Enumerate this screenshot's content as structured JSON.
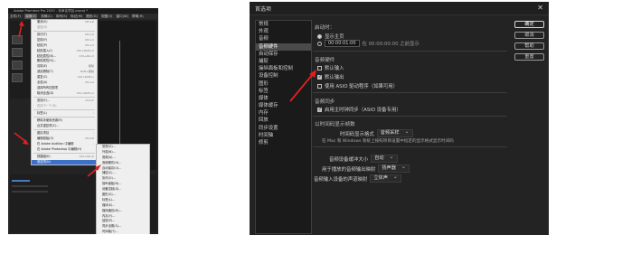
{
  "left_app": {
    "title": "Adobe Premiere Pro 2020 - 未命名项目.prproj *",
    "menubar": [
      "文件(F)",
      "编辑(E)",
      "剪辑(C)",
      "序列(S)",
      "标记(M)",
      "图形(G)",
      "视图(V)",
      "窗口(W)",
      "帮助(H)"
    ],
    "active_menu_index": 1,
    "edit_menu": [
      {
        "label": "撤消(U)",
        "shortcut": "Ctrl+Z"
      },
      {
        "label": "重做(R)",
        "shortcut": "",
        "disabled": true
      },
      {
        "sep": true
      },
      {
        "label": "剪切(T)",
        "shortcut": "Ctrl+X"
      },
      {
        "label": "复制(Y)",
        "shortcut": "Ctrl+C"
      },
      {
        "label": "粘贴(P)",
        "shortcut": "Ctrl+V"
      },
      {
        "label": "粘贴插入(I)",
        "shortcut": "Ctrl+Shift+V"
      },
      {
        "label": "粘贴属性(B)...",
        "shortcut": "Ctrl+Alt+V"
      },
      {
        "label": "删除属性(R)...",
        "shortcut": ""
      },
      {
        "label": "清除(E)",
        "shortcut": "删除"
      },
      {
        "label": "波纹删除(T)",
        "shortcut": "Shift+删除"
      },
      {
        "label": "重复(C)",
        "shortcut": "Ctrl+Shift+/"
      },
      {
        "label": "全选(A)",
        "shortcut": "Ctrl+A"
      },
      {
        "label": "选择所有匹配项",
        "shortcut": ""
      },
      {
        "label": "取消全选(D)",
        "shortcut": "Ctrl+Shift+A"
      },
      {
        "sep": true
      },
      {
        "label": "查找(F)...",
        "shortcut": "Ctrl+F"
      },
      {
        "label": "查找下一个(N)",
        "shortcut": "",
        "disabled": true
      },
      {
        "sep": true
      },
      {
        "label": "标签(L)",
        "shortcut": "",
        "submenu": true
      },
      {
        "sep": true
      },
      {
        "label": "移除未使用资源(R)",
        "shortcut": ""
      },
      {
        "label": "合并重复项(C)...",
        "shortcut": ""
      },
      {
        "sep": true
      },
      {
        "label": "团队项目",
        "shortcut": "",
        "submenu": true
      },
      {
        "label": "编辑原始(O)",
        "shortcut": "Ctrl+E"
      },
      {
        "label": "在 Adobe Audition 中编辑",
        "shortcut": "",
        "submenu": true
      },
      {
        "label": "在 Adobe Photoshop 中编辑(H)",
        "shortcut": ""
      },
      {
        "sep": true
      },
      {
        "label": "快捷键(K)",
        "shortcut": "Ctrl+Alt+K"
      },
      {
        "label": "首选项(N)",
        "shortcut": "",
        "submenu": true,
        "highlight": true
      }
    ],
    "prefs_submenu": [
      {
        "label": "常规(G)..."
      },
      {
        "label": "外观(N)..."
      },
      {
        "label": "音频(A)..."
      },
      {
        "label": "音频硬件(H)..."
      },
      {
        "label": "自动保存(U)..."
      },
      {
        "label": "捕捉(C)..."
      },
      {
        "label": "协作(O)..."
      },
      {
        "label": "操纵面板(N)..."
      },
      {
        "label": "设备控制(D)..."
      },
      {
        "label": "图形(G)..."
      },
      {
        "label": "标签(L)..."
      },
      {
        "label": "媒体(E)..."
      },
      {
        "label": "媒体缓存(M)..."
      },
      {
        "label": "内存(Y)..."
      },
      {
        "label": "回放(P)..."
      },
      {
        "label": "同步设置(S)..."
      },
      {
        "label": "时间轴(T)..."
      },
      {
        "label": "修剪(R)..."
      }
    ]
  },
  "dialog": {
    "title": "首选项",
    "categories": [
      "常规",
      "外观",
      "音频",
      "音频硬件",
      "自动保存",
      "捕捉",
      "操纵面板和控制",
      "设备控制",
      "图形",
      "标签",
      "媒体",
      "媒体缓存",
      "内存",
      "回放",
      "同步设置",
      "时间轴",
      "修剪"
    ],
    "categories_visible": [
      "常规",
      "外观",
      "音频",
      "音频硬件",
      "自动保存",
      "捕捉",
      "操纵面板和控制",
      "设备控制",
      "图形",
      "标签",
      "媒体",
      "媒体缓存",
      "内存",
      "回放",
      "同步设置",
      "时间轴",
      "修剪"
    ],
    "selected_category_index": 3,
    "sections": {
      "startup_header": "启动时：",
      "startup_option1": "显示主页",
      "startup_option2": "打开最近使用的项目",
      "startup_timecode": "00:00:01:00",
      "startup_note": "在 00:00:00:00 之前显示",
      "audio_header": "音频硬件",
      "audio_cb1": "默认输入",
      "audio_cb2": "默认输出",
      "audio_cb3": "使用 ASIO 驱动程序（如果可用）",
      "sync_header": "音频同步",
      "sync_cb1": "启用主时钟同步（ASIO 设备专用）",
      "render_header": "以时间码显示帧数",
      "render_label": "时间码显示格式",
      "render_value": "音频采样",
      "render_note": "在 Mac 和 Windows 系统上按照项目设置中指定的显示格式显示时间码",
      "bottom_label1": "音频设备缓冲大小",
      "bottom_value1": "自动",
      "bottom_label2": "用于播放的音频输出映射",
      "bottom_value2": "扬声器",
      "bottom_label3": "音频输入设备的声道映射",
      "bottom_value3": "立体声"
    },
    "buttons": {
      "primary": "确定",
      "cancel": "取消",
      "help": "帮助",
      "reset": "重置"
    }
  },
  "colors": {
    "dialog_bg": "#232323",
    "accent_red": "#e02020",
    "menu_highlight": "#3d71c8"
  }
}
